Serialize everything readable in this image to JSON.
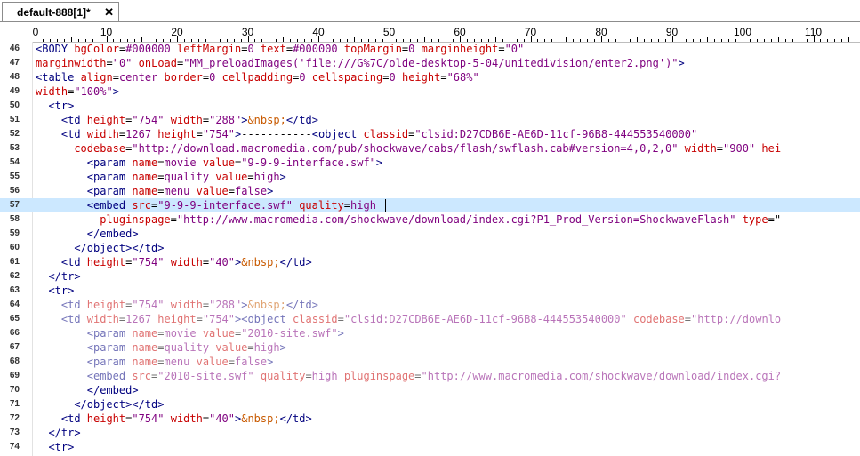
{
  "tab": {
    "title": "default-888[1]*",
    "close_label": "✕"
  },
  "ruler": {
    "labels": [
      "0",
      "10",
      "20",
      "30",
      "40",
      "50",
      "60",
      "70",
      "80",
      "90",
      "100",
      "110"
    ]
  },
  "colors": {
    "tag": "#00007f",
    "attr": "#c80000",
    "string": "#7f007f",
    "entity": "#c85a00",
    "highlight": "#cce8ff"
  },
  "editor": {
    "highlighted_line": "57",
    "lines": [
      {
        "n": "46",
        "indent": 0,
        "faded": false,
        "tokens": [
          [
            "t",
            "<BODY "
          ],
          [
            "a",
            "bgColor"
          ],
          [
            "p",
            "="
          ],
          [
            "s",
            "#000000"
          ],
          [
            "p",
            " "
          ],
          [
            "a",
            "leftMargin"
          ],
          [
            "p",
            "="
          ],
          [
            "s",
            "0"
          ],
          [
            "p",
            " "
          ],
          [
            "a",
            "text"
          ],
          [
            "p",
            "="
          ],
          [
            "s",
            "#000000"
          ],
          [
            "p",
            " "
          ],
          [
            "a",
            "topMargin"
          ],
          [
            "p",
            "="
          ],
          [
            "s",
            "0"
          ],
          [
            "p",
            " "
          ],
          [
            "a",
            "marginheight"
          ],
          [
            "p",
            "="
          ],
          [
            "s",
            "\"0\""
          ]
        ]
      },
      {
        "n": "47",
        "indent": 0,
        "faded": false,
        "tokens": [
          [
            "a",
            "marginwidth"
          ],
          [
            "p",
            "="
          ],
          [
            "s",
            "\"0\""
          ],
          [
            "p",
            " "
          ],
          [
            "a",
            "onLoad"
          ],
          [
            "p",
            "="
          ],
          [
            "s",
            "\"MM_preloadImages('file:///G%7C/olde-desktop-5-04/unitedivision/enter2.png')\""
          ],
          [
            "t",
            ">"
          ]
        ]
      },
      {
        "n": "48",
        "indent": 0,
        "faded": false,
        "tokens": [
          [
            "t",
            "<table "
          ],
          [
            "a",
            "align"
          ],
          [
            "p",
            "="
          ],
          [
            "s",
            "center"
          ],
          [
            "p",
            " "
          ],
          [
            "a",
            "border"
          ],
          [
            "p",
            "="
          ],
          [
            "s",
            "0"
          ],
          [
            "p",
            " "
          ],
          [
            "a",
            "cellpadding"
          ],
          [
            "p",
            "="
          ],
          [
            "s",
            "0"
          ],
          [
            "p",
            " "
          ],
          [
            "a",
            "cellspacing"
          ],
          [
            "p",
            "="
          ],
          [
            "s",
            "0"
          ],
          [
            "p",
            " "
          ],
          [
            "a",
            "height"
          ],
          [
            "p",
            "="
          ],
          [
            "s",
            "\"68%\""
          ]
        ]
      },
      {
        "n": "49",
        "indent": 0,
        "faded": false,
        "tokens": [
          [
            "a",
            "width"
          ],
          [
            "p",
            "="
          ],
          [
            "s",
            "\"100%\""
          ],
          [
            "t",
            ">"
          ]
        ]
      },
      {
        "n": "50",
        "indent": 2,
        "faded": false,
        "tokens": [
          [
            "t",
            "<tr>"
          ]
        ]
      },
      {
        "n": "51",
        "indent": 4,
        "faded": false,
        "tokens": [
          [
            "t",
            "<td "
          ],
          [
            "a",
            "height"
          ],
          [
            "p",
            "="
          ],
          [
            "s",
            "\"754\""
          ],
          [
            "p",
            " "
          ],
          [
            "a",
            "width"
          ],
          [
            "p",
            "="
          ],
          [
            "s",
            "\"288\""
          ],
          [
            "t",
            ">"
          ],
          [
            "e",
            "&nbsp;"
          ],
          [
            "t",
            "</td>"
          ]
        ]
      },
      {
        "n": "52",
        "indent": 4,
        "faded": false,
        "tokens": [
          [
            "t",
            "<td "
          ],
          [
            "a",
            "width"
          ],
          [
            "p",
            "="
          ],
          [
            "s",
            "1267"
          ],
          [
            "p",
            " "
          ],
          [
            "a",
            "height"
          ],
          [
            "p",
            "="
          ],
          [
            "s",
            "\"754\""
          ],
          [
            "t",
            ">"
          ],
          [
            "p",
            "-----------"
          ],
          [
            "t",
            "<object "
          ],
          [
            "a",
            "classid"
          ],
          [
            "p",
            "="
          ],
          [
            "s",
            "\"clsid:D27CDB6E-AE6D-11cf-96B8-444553540000\""
          ]
        ]
      },
      {
        "n": "53",
        "indent": 6,
        "faded": false,
        "tokens": [
          [
            "a",
            "codebase"
          ],
          [
            "p",
            "="
          ],
          [
            "s",
            "\"http://download.macromedia.com/pub/shockwave/cabs/flash/swflash.cab#version=4,0,2,0\""
          ],
          [
            "p",
            " "
          ],
          [
            "a",
            "width"
          ],
          [
            "p",
            "="
          ],
          [
            "s",
            "\"900\""
          ],
          [
            "p",
            " "
          ],
          [
            "a",
            "hei"
          ]
        ]
      },
      {
        "n": "54",
        "indent": 8,
        "faded": false,
        "tokens": [
          [
            "t",
            "<param "
          ],
          [
            "a",
            "name"
          ],
          [
            "p",
            "="
          ],
          [
            "s",
            "movie"
          ],
          [
            "p",
            " "
          ],
          [
            "a",
            "value"
          ],
          [
            "p",
            "="
          ],
          [
            "s",
            "\"9-9-9-interface.swf\""
          ],
          [
            "t",
            ">"
          ]
        ]
      },
      {
        "n": "55",
        "indent": 8,
        "faded": false,
        "tokens": [
          [
            "t",
            "<param "
          ],
          [
            "a",
            "name"
          ],
          [
            "p",
            "="
          ],
          [
            "s",
            "quality"
          ],
          [
            "p",
            " "
          ],
          [
            "a",
            "value"
          ],
          [
            "p",
            "="
          ],
          [
            "s",
            "high"
          ],
          [
            "t",
            ">"
          ]
        ]
      },
      {
        "n": "56",
        "indent": 8,
        "faded": false,
        "tokens": [
          [
            "t",
            "<param "
          ],
          [
            "a",
            "name"
          ],
          [
            "p",
            "="
          ],
          [
            "s",
            "menu"
          ],
          [
            "p",
            " "
          ],
          [
            "a",
            "value"
          ],
          [
            "p",
            "="
          ],
          [
            "s",
            "false"
          ],
          [
            "t",
            ">"
          ]
        ]
      },
      {
        "n": "57",
        "indent": 8,
        "faded": false,
        "tokens": [
          [
            "t",
            "<embed "
          ],
          [
            "a",
            "src"
          ],
          [
            "p",
            "="
          ],
          [
            "s",
            "\"9-9-9-interface.swf\""
          ],
          [
            "p",
            " "
          ],
          [
            "a",
            "quality"
          ],
          [
            "p",
            "="
          ],
          [
            "s",
            "high"
          ]
        ]
      },
      {
        "n": "58",
        "indent": 10,
        "faded": false,
        "tokens": [
          [
            "a",
            "pluginspage"
          ],
          [
            "p",
            "="
          ],
          [
            "s",
            "\"http://www.macromedia.com/shockwave/download/index.cgi?P1_Prod_Version=ShockwaveFlash\""
          ],
          [
            "p",
            " "
          ],
          [
            "a",
            "type"
          ],
          [
            "p",
            "=\""
          ]
        ]
      },
      {
        "n": "59",
        "indent": 8,
        "faded": false,
        "tokens": [
          [
            "t",
            "</embed>"
          ]
        ]
      },
      {
        "n": "60",
        "indent": 6,
        "faded": false,
        "tokens": [
          [
            "t",
            "</object></td>"
          ]
        ]
      },
      {
        "n": "61",
        "indent": 4,
        "faded": false,
        "tokens": [
          [
            "t",
            "<td "
          ],
          [
            "a",
            "height"
          ],
          [
            "p",
            "="
          ],
          [
            "s",
            "\"754\""
          ],
          [
            "p",
            " "
          ],
          [
            "a",
            "width"
          ],
          [
            "p",
            "="
          ],
          [
            "s",
            "\"40\""
          ],
          [
            "t",
            ">"
          ],
          [
            "e",
            "&nbsp;"
          ],
          [
            "t",
            "</td>"
          ]
        ]
      },
      {
        "n": "62",
        "indent": 2,
        "faded": false,
        "tokens": [
          [
            "t",
            "</tr>"
          ]
        ]
      },
      {
        "n": "63",
        "indent": 2,
        "faded": false,
        "tokens": [
          [
            "t",
            "<tr>"
          ]
        ]
      },
      {
        "n": "64",
        "indent": 4,
        "faded": true,
        "tokens": [
          [
            "t",
            "<td "
          ],
          [
            "a",
            "height"
          ],
          [
            "p",
            "="
          ],
          [
            "s",
            "\"754\""
          ],
          [
            "p",
            " "
          ],
          [
            "a",
            "width"
          ],
          [
            "p",
            "="
          ],
          [
            "s",
            "\"288\""
          ],
          [
            "t",
            ">"
          ],
          [
            "e",
            "&nbsp;"
          ],
          [
            "t",
            "</td>"
          ]
        ]
      },
      {
        "n": "65",
        "indent": 4,
        "faded": true,
        "tokens": [
          [
            "t",
            "<td "
          ],
          [
            "a",
            "width"
          ],
          [
            "p",
            "="
          ],
          [
            "s",
            "1267"
          ],
          [
            "p",
            " "
          ],
          [
            "a",
            "height"
          ],
          [
            "p",
            "="
          ],
          [
            "s",
            "\"754\""
          ],
          [
            "t",
            "><object "
          ],
          [
            "a",
            "classid"
          ],
          [
            "p",
            "="
          ],
          [
            "s",
            "\"clsid:D27CDB6E-AE6D-11cf-96B8-444553540000\""
          ],
          [
            "p",
            " "
          ],
          [
            "a",
            "codebase"
          ],
          [
            "p",
            "="
          ],
          [
            "s",
            "\"http://downlo"
          ]
        ]
      },
      {
        "n": "66",
        "indent": 8,
        "faded": true,
        "tokens": [
          [
            "t",
            "<param "
          ],
          [
            "a",
            "name"
          ],
          [
            "p",
            "="
          ],
          [
            "s",
            "movie"
          ],
          [
            "p",
            " "
          ],
          [
            "a",
            "value"
          ],
          [
            "p",
            "="
          ],
          [
            "s",
            "\"2010-site.swf\""
          ],
          [
            "t",
            ">"
          ]
        ]
      },
      {
        "n": "67",
        "indent": 8,
        "faded": true,
        "tokens": [
          [
            "t",
            "<param "
          ],
          [
            "a",
            "name"
          ],
          [
            "p",
            "="
          ],
          [
            "s",
            "quality"
          ],
          [
            "p",
            " "
          ],
          [
            "a",
            "value"
          ],
          [
            "p",
            "="
          ],
          [
            "s",
            "high"
          ],
          [
            "t",
            ">"
          ]
        ]
      },
      {
        "n": "68",
        "indent": 8,
        "faded": true,
        "tokens": [
          [
            "t",
            "<param "
          ],
          [
            "a",
            "name"
          ],
          [
            "p",
            "="
          ],
          [
            "s",
            "menu"
          ],
          [
            "p",
            " "
          ],
          [
            "a",
            "value"
          ],
          [
            "p",
            "="
          ],
          [
            "s",
            "false"
          ],
          [
            "t",
            ">"
          ]
        ]
      },
      {
        "n": "69",
        "indent": 8,
        "faded": true,
        "tokens": [
          [
            "t",
            "<embed "
          ],
          [
            "a",
            "src"
          ],
          [
            "p",
            "="
          ],
          [
            "s",
            "\"2010-site.swf\""
          ],
          [
            "p",
            " "
          ],
          [
            "a",
            "quality"
          ],
          [
            "p",
            "="
          ],
          [
            "s",
            "high"
          ],
          [
            "p",
            " "
          ],
          [
            "a",
            "pluginspage"
          ],
          [
            "p",
            "="
          ],
          [
            "s",
            "\"http://www.macromedia.com/shockwave/download/index.cgi?"
          ]
        ]
      },
      {
        "n": "70",
        "indent": 8,
        "faded": false,
        "tokens": [
          [
            "t",
            "</embed>"
          ]
        ]
      },
      {
        "n": "71",
        "indent": 6,
        "faded": false,
        "tokens": [
          [
            "t",
            "</object></td>"
          ]
        ]
      },
      {
        "n": "72",
        "indent": 4,
        "faded": false,
        "tokens": [
          [
            "t",
            "<td "
          ],
          [
            "a",
            "height"
          ],
          [
            "p",
            "="
          ],
          [
            "s",
            "\"754\""
          ],
          [
            "p",
            " "
          ],
          [
            "a",
            "width"
          ],
          [
            "p",
            "="
          ],
          [
            "s",
            "\"40\""
          ],
          [
            "t",
            ">"
          ],
          [
            "e",
            "&nbsp;"
          ],
          [
            "t",
            "</td>"
          ]
        ]
      },
      {
        "n": "73",
        "indent": 2,
        "faded": false,
        "tokens": [
          [
            "t",
            "</tr>"
          ]
        ]
      },
      {
        "n": "74",
        "indent": 2,
        "faded": false,
        "tokens": [
          [
            "t",
            "<tr>"
          ]
        ]
      }
    ]
  }
}
